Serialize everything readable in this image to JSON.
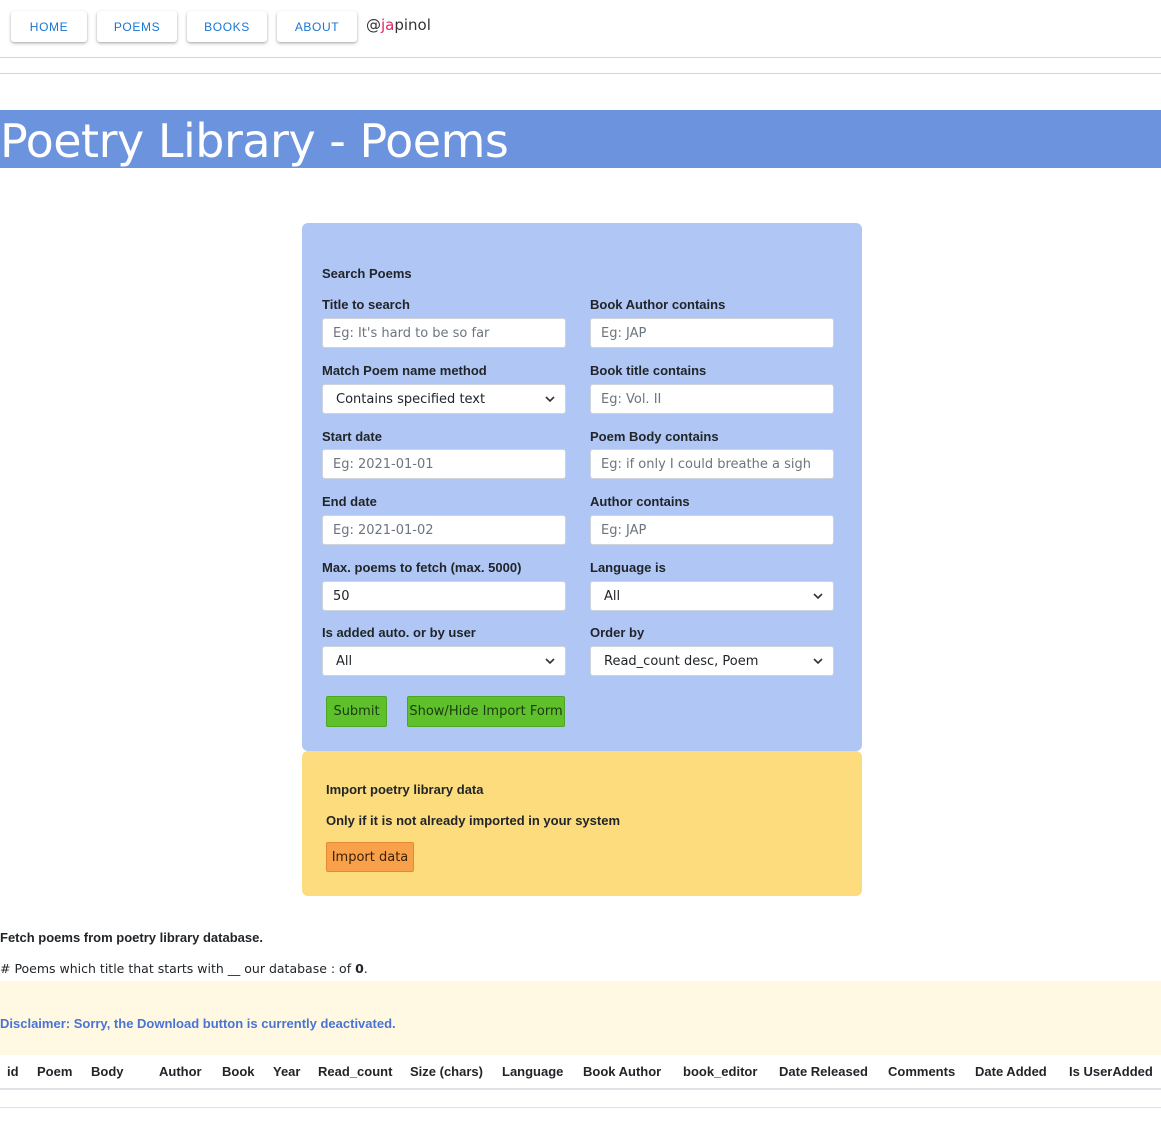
{
  "nav": {
    "home": "HOME",
    "poems": "POEMS",
    "books": "BOOKS",
    "about": "ABOUT",
    "handle_prefix": "@",
    "handle_accent": "ja",
    "handle_rest": "pinol"
  },
  "banner": {
    "title": "Poetry Library - Poems"
  },
  "search": {
    "title": "Search Poems",
    "title_to_search_label": "Title to search",
    "title_to_search_placeholder": "Eg: It's hard to be so far",
    "book_author_label": "Book Author contains",
    "book_author_placeholder": "Eg: JAP",
    "match_method_label": "Match Poem name method",
    "match_method_value": "Contains specified text",
    "book_title_label": "Book title contains",
    "book_title_placeholder": "Eg: Vol. II",
    "start_date_label": "Start date",
    "start_date_placeholder": "Eg: 2021-01-01",
    "poem_body_label": "Poem Body contains",
    "poem_body_placeholder": "Eg: if only I could breathe a sigh",
    "end_date_label": "End date",
    "end_date_placeholder": "Eg: 2021-01-02",
    "author_label": "Author contains",
    "author_placeholder": "Eg: JAP",
    "max_poems_label": "Max. poems to fetch (max. 5000)",
    "max_poems_value": "50",
    "language_label": "Language is",
    "language_value": "All",
    "added_by_label": "Is added auto. or by user",
    "added_by_value": "All",
    "order_by_label": "Order by",
    "order_by_value": "Read_count desc, Poem",
    "submit_label": "Submit",
    "toggle_import_label": "Show/Hide Import Form"
  },
  "import": {
    "title": "Import poetry library data",
    "note": "Only if it is not already imported in your system",
    "button_label": "Import data"
  },
  "results": {
    "fetch_title": "Fetch poems from poetry library database.",
    "count_text": "# Poems which title that starts with __ our database : of ",
    "count_value": "0",
    "count_suffix": ".",
    "disclaimer": "Disclaimer: Sorry, the Download button is currently deactivated."
  },
  "table": {
    "headers": [
      "id",
      "Poem",
      "Body",
      "Author",
      "Book",
      "Year",
      "Read_count",
      "Size (chars)",
      "Language",
      "Book Author",
      "book_editor",
      "Date Released",
      "Comments",
      "Date Added",
      "Is UserAdded"
    ]
  },
  "colors": {
    "banner": "#6c93dd",
    "search_panel": "#b0c6f5",
    "import_panel": "#fddc7d",
    "green_button": "#5ec02b",
    "orange_button": "#f9a04a",
    "nav_text": "#1976d2",
    "disclaimer_text": "#4a74d4"
  }
}
